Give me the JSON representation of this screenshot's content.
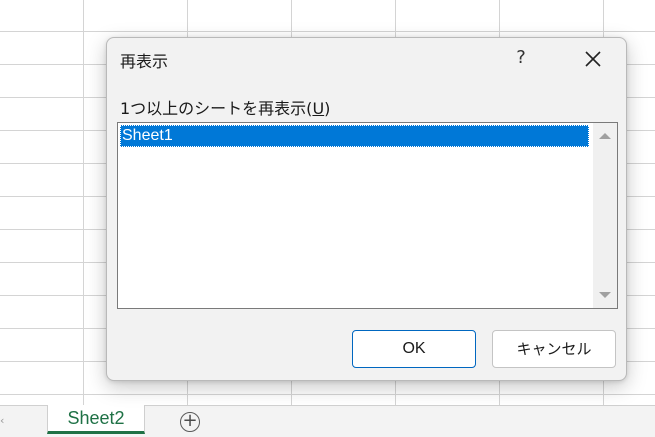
{
  "dialog": {
    "title": "再表示",
    "help_label": "?",
    "list_label_prefix": "1つ以上のシートを再表示(",
    "list_label_accel": "U",
    "list_label_suffix": ")",
    "hidden_sheets": [
      "Sheet1"
    ],
    "selected_index": 0,
    "ok_label": "OK",
    "cancel_label": "キャンセル"
  },
  "tabbar": {
    "active_sheet": "Sheet2",
    "tab_color": "#1e7145"
  },
  "colors": {
    "selection": "#0078d7",
    "dialog_bg": "#f2f2f2",
    "ok_border": "#0067c0"
  },
  "icons": {
    "close": "close-icon",
    "add_sheet": "plus-circle-icon",
    "scroll_up": "scroll-up-arrow-icon",
    "scroll_down": "scroll-down-arrow-icon",
    "tab_scroll_left": "chevron-left-icon"
  }
}
